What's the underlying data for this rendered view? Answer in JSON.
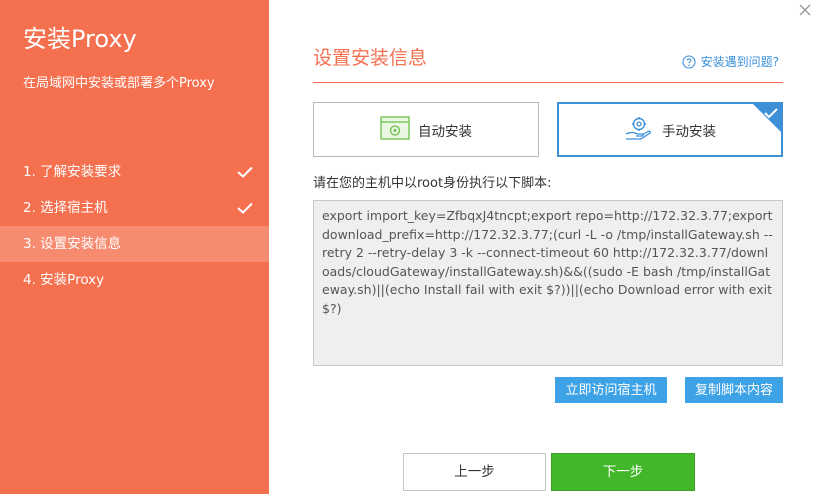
{
  "sidebar": {
    "title": "安装Proxy",
    "subtitle": "在局域网中安装或部署多个Proxy",
    "steps": [
      {
        "label": "1. 了解安装要求",
        "done": true
      },
      {
        "label": "2. 选择宿主机",
        "done": true
      },
      {
        "label": "3. 设置安装信息",
        "active": true
      },
      {
        "label": "4. 安装Proxy"
      }
    ]
  },
  "main": {
    "title": "设置安装信息",
    "help_label": "安装遇到问题?",
    "options": {
      "auto_label": "自动安装",
      "manual_label": "手动安装",
      "selected": "manual"
    },
    "instruction": "请在您的主机中以root身份执行以下脚本:",
    "script": "export import_key=ZfbqxJ4tncpt;export repo=http://172.32.3.77;export download_prefix=http://172.32.3.77;(curl -L -o /tmp/installGateway.sh --retry 2 --retry-delay 3 -k --connect-timeout 60 http://172.32.3.77/downloads/cloudGateway/installGateway.sh)&&((sudo -E bash /tmp/installGateway.sh)||(echo Install fail with exit $?))||(echo Download error with exit $?)",
    "visit_host_label": "立即访问宿主机",
    "copy_script_label": "复制脚本内容"
  },
  "footer": {
    "prev_label": "上一步",
    "next_label": "下一步"
  },
  "colors": {
    "sidebar": "#f4704f",
    "accent_blue": "#3d8fd6",
    "button_blue": "#3da2e6",
    "next_green": "#42b72a"
  }
}
